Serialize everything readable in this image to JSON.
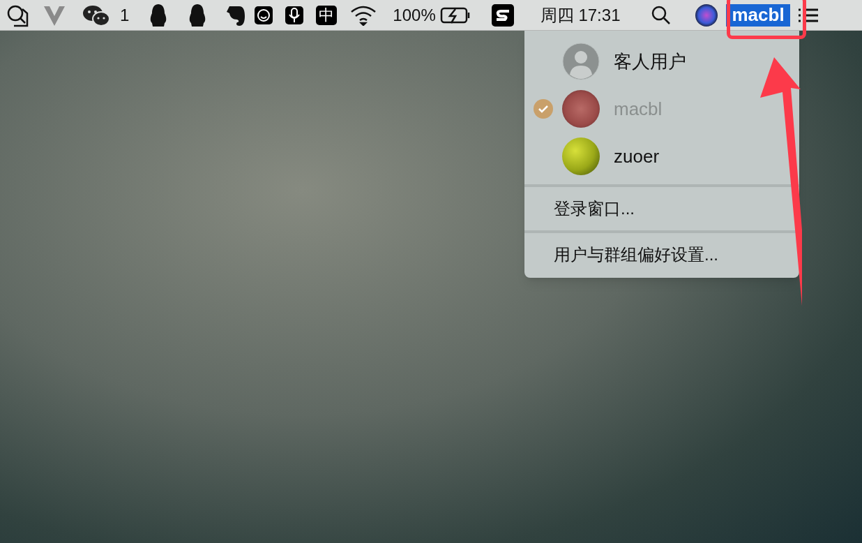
{
  "menu_bar": {
    "chat_badge": "1",
    "input_method": "中",
    "battery": "100%",
    "clock": "周四 17:31",
    "user": {
      "label": "macbl",
      "selected": true
    }
  },
  "user_menu": {
    "users": [
      {
        "name": "客人用户",
        "kind": "guest",
        "selected": false,
        "disabled": false
      },
      {
        "name": "macbl",
        "kind": "rose",
        "selected": true,
        "disabled": true
      },
      {
        "name": "zuoer",
        "kind": "ball",
        "selected": false,
        "disabled": false
      }
    ],
    "items": [
      "登录窗口...",
      "用户与群组偏好设置..."
    ]
  }
}
